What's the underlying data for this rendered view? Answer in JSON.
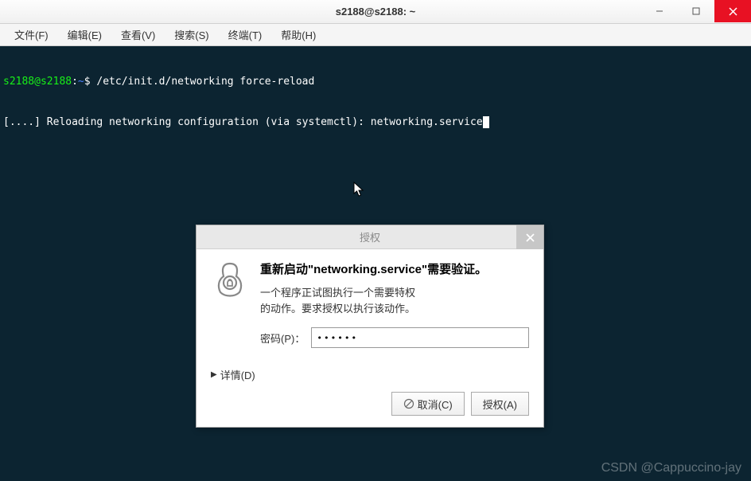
{
  "window": {
    "title": "s2188@s2188: ~"
  },
  "menu": {
    "file": "文件(F)",
    "edit": "编辑(E)",
    "view": "查看(V)",
    "search": "搜索(S)",
    "terminal": "终端(T)",
    "help": "帮助(H)"
  },
  "terminal": {
    "prompt_user": "s2188@s2188",
    "prompt_sep": ":",
    "prompt_path": "~",
    "prompt_symbol": "$",
    "command": " /etc/init.d/networking force-reload",
    "output1": "[....] Reloading networking configuration (via systemctl): networking.service"
  },
  "dialog": {
    "title": "授权",
    "heading": "重新启动\"networking.service\"需要验证。",
    "desc_line1": "一个程序正试图执行一个需要特权",
    "desc_line2": "的动作。要求授权以执行该动作。",
    "password_label": "密码(P)：",
    "password_value": "••••••",
    "details_label": "详情(D)",
    "cancel_label": "取消(C)",
    "authorize_label": "授权(A)"
  },
  "watermark": "CSDN @Cappuccino-jay"
}
